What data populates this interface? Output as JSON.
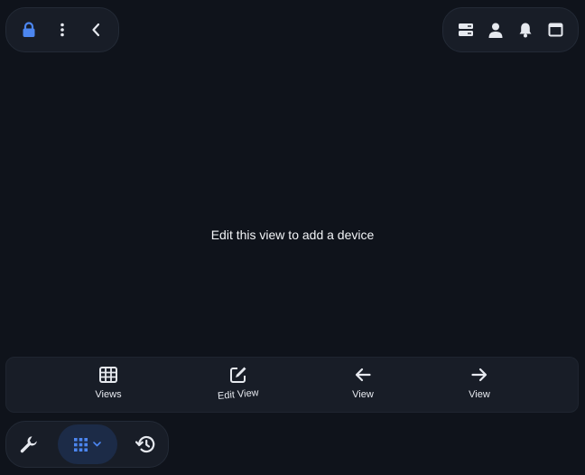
{
  "main": {
    "empty_message": "Edit this view to add a device"
  },
  "bottom_nav": {
    "items": [
      {
        "label": "Views",
        "icon": "grid-icon"
      },
      {
        "label": "Edit View",
        "icon": "edit-icon"
      },
      {
        "label": "View",
        "icon": "arrow-left-icon"
      },
      {
        "label": "View",
        "icon": "arrow-right-icon"
      }
    ]
  },
  "top_left_toolbar": {
    "icons": [
      "lock-icon",
      "more-vertical-icon",
      "chevron-left-icon"
    ]
  },
  "top_right_toolbar": {
    "icons": [
      "server-icon",
      "user-icon",
      "bell-icon",
      "window-icon"
    ]
  },
  "bottom_left_toolbar": {
    "icons": [
      "wrench-icon",
      "apps-grid-icon",
      "chevron-down-icon",
      "history-icon"
    ]
  },
  "colors": {
    "background": "#0f131b",
    "panel": "#181d27",
    "accent_blue": "#4c86f0",
    "apps_button_bg": "#1c2b47",
    "icon": "#e6e9ef"
  }
}
